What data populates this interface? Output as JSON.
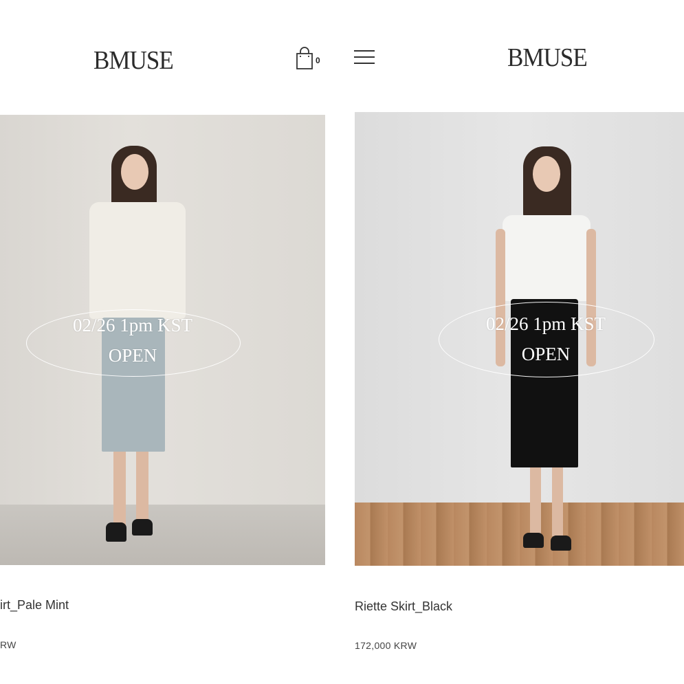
{
  "left": {
    "logo": "BMUSE",
    "cart_count": "0",
    "banner_line1": "02/26 1pm KST",
    "banner_line2": "OPEN",
    "product_name": "irt_Pale Mint",
    "price": "RW"
  },
  "right": {
    "logo": "BMUSE",
    "banner_line1": "02/26 1pm KST",
    "banner_line2": "OPEN",
    "product_name": "Riette Skirt_Black",
    "price": "172,000 KRW"
  },
  "icons": [
    "shopping-bag-icon",
    "menu-icon"
  ],
  "colors": {
    "text": "#222222",
    "background": "#ffffff",
    "mint_skirt": "#a9b6bb",
    "black_skirt": "#111111"
  }
}
